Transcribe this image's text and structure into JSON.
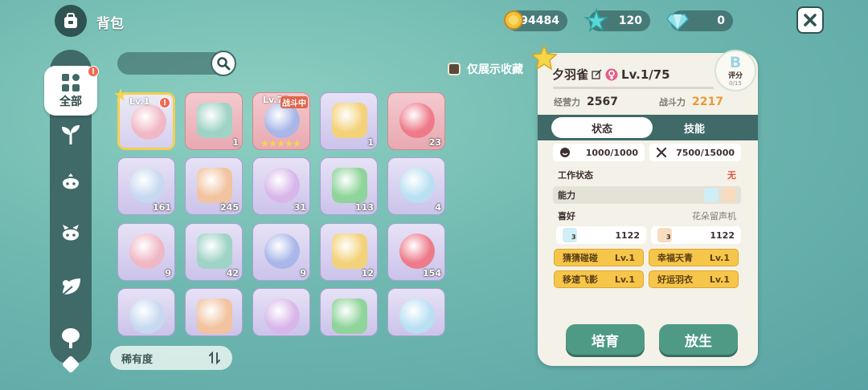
{
  "header": {
    "title": "背包"
  },
  "resources": [
    {
      "icon": "gold-coin-icon",
      "value": "94484"
    },
    {
      "icon": "blue-star-icon",
      "value": "120"
    },
    {
      "icon": "gem-icon",
      "value": "0"
    }
  ],
  "sidebar": {
    "items": [
      {
        "icon": "grid-icon",
        "label": "全部",
        "active": true,
        "badge": "!"
      },
      {
        "icon": "sprout-icon",
        "label": ""
      },
      {
        "icon": "creature-icon",
        "label": ""
      },
      {
        "icon": "creature-icon",
        "label": ""
      },
      {
        "icon": "leaf-icon",
        "label": ""
      },
      {
        "icon": "tree-icon",
        "label": ""
      }
    ]
  },
  "filter": {
    "favorites_only_label": "仅展示收藏",
    "sort_label": "稀有度"
  },
  "grid": {
    "rows": [
      [
        {
          "name": "owl-creature",
          "level": "Lv.1",
          "badge": "!",
          "selected": true,
          "favorite": true
        },
        {
          "name": "blackboard",
          "count": "1"
        },
        {
          "name": "battle-creature",
          "level": "Lv.75",
          "status": "战斗中",
          "stars": 5
        },
        {
          "name": "box",
          "count": "1"
        },
        {
          "name": "heart",
          "count": "23"
        }
      ],
      [
        {
          "name": "bottle",
          "count": "161"
        },
        {
          "name": "spray",
          "count": "245"
        },
        {
          "name": "paw-cookie",
          "count": "31"
        },
        {
          "name": "green-gem",
          "count": "113"
        },
        {
          "name": "ticket-cloud",
          "count": "4"
        }
      ],
      [
        {
          "name": "ticket-pink-male",
          "count": "9"
        },
        {
          "name": "ticket-character",
          "count": "42"
        },
        {
          "name": "ticket-ice",
          "count": "9"
        },
        {
          "name": "ticket-purple-male",
          "count": "12"
        },
        {
          "name": "ticket-pudding",
          "count": "154"
        }
      ],
      [
        {
          "name": "net"
        },
        {
          "name": "ticket-yellow"
        },
        {
          "name": "fish-sturgeon"
        },
        {
          "name": "fish-gold"
        },
        {
          "name": "fish-blue"
        }
      ]
    ]
  },
  "detail": {
    "name": "夕羽雀",
    "level": "Lv.1/75",
    "grade": "B",
    "grade_label": "评分",
    "grade_score": "0/15",
    "labels": {
      "management": "经营力",
      "combat": "战斗力"
    },
    "management_value": "2567",
    "combat_value": "2217",
    "tabs": [
      "状态",
      "技能"
    ],
    "hunger": "1000/1000",
    "durability": "7500/15000",
    "work_status_label": "工作状态",
    "work_status_value": "无",
    "ability_label": "能力",
    "preference_label": "喜好",
    "preference_value": "花朵留声机",
    "affinities": [
      {
        "icon": "water-icon",
        "level": "3",
        "value": "1122"
      },
      {
        "icon": "hand-icon",
        "level": "3",
        "value": "1122"
      }
    ],
    "traits": [
      {
        "name": "猜猜碰碰",
        "level": "Lv.1"
      },
      {
        "name": "幸福天青",
        "level": "Lv.1"
      },
      {
        "name": "移速飞影",
        "level": "Lv.1"
      },
      {
        "name": "好运羽衣",
        "level": "Lv.1"
      }
    ],
    "actions": {
      "nurture": "培育",
      "release": "放生"
    }
  },
  "colors": {
    "accent": "#3f6a68",
    "button": "#4e9a85",
    "trait": "#f6c64a",
    "combat": "#e79a3a",
    "alert": "#ec6a52"
  }
}
